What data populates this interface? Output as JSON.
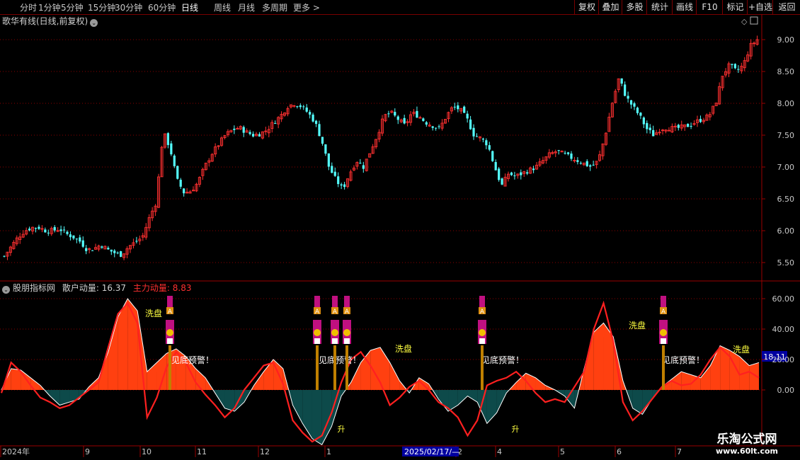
{
  "toolbar": {
    "tabs": [
      "分时",
      "1分钟",
      "5分钟",
      "15分钟",
      "30分钟",
      "60分钟",
      "日线",
      "周线",
      "月线",
      "多周期",
      "更多 >"
    ],
    "active_tab": "日线",
    "right_buttons": [
      "复权",
      "叠加",
      "多股",
      "统计",
      "画线",
      "F10",
      "标记",
      "+自选",
      "返回"
    ]
  },
  "main_panel": {
    "title": "歌华有线(日线,前复权)"
  },
  "indicator_panel": {
    "name": "股朋指标网",
    "retail_label": "散户动量: 16.37",
    "main_label": "主力动量: 8.83",
    "value_badge": "18.11"
  },
  "xaxis": {
    "labels": [
      "2024年",
      "9",
      "10",
      "11",
      "12",
      "1",
      "2",
      "4",
      "5",
      "6",
      "7"
    ],
    "cursor_date": "2025/02/17/—"
  },
  "watermark": {
    "line1": "乐淘公式网",
    "line2": "www.60lt.com"
  },
  "colors": {
    "up": "#ff3030",
    "down": "#54ffff",
    "grid": "#8b0000",
    "fill_pos": "#ff4010",
    "fill_neg": "#0d4a4a",
    "main_line": "#ff2020",
    "retail_line": "#ffffff"
  },
  "chart_data": [
    {
      "type": "candlestick",
      "title": "歌华有线(日线,前复权)",
      "ylim": [
        5.4,
        9.2
      ],
      "yticks": [
        "5.50",
        "6.00",
        "6.50",
        "7.00",
        "7.50",
        "8.00",
        "8.50",
        "9.00"
      ],
      "close_series": [
        5.6,
        5.75,
        5.9,
        6.0,
        6.05,
        6.05,
        6.0,
        6.0,
        6.03,
        5.95,
        5.9,
        5.83,
        5.7,
        5.72,
        5.78,
        5.7,
        5.65,
        5.62,
        5.75,
        5.82,
        5.9,
        6.2,
        6.45,
        7.55,
        7.3,
        6.8,
        6.6,
        6.62,
        6.75,
        7.0,
        7.2,
        7.35,
        7.5,
        7.58,
        7.62,
        7.55,
        7.5,
        7.52,
        7.58,
        7.7,
        7.8,
        7.95,
        8.0,
        7.95,
        7.85,
        7.7,
        7.4,
        7.0,
        6.8,
        6.65,
        6.9,
        7.1,
        7.0,
        7.25,
        7.5,
        7.8,
        7.85,
        7.75,
        7.65,
        7.85,
        7.8,
        7.7,
        7.65,
        7.6,
        7.8,
        7.95,
        7.9,
        7.75,
        7.5,
        7.45,
        7.35,
        7.0,
        6.7,
        6.9,
        6.85,
        6.9,
        6.95,
        7.0,
        7.1,
        7.2,
        7.25,
        7.2,
        7.15,
        7.1,
        7.05,
        7.0,
        7.1,
        7.5,
        8.0,
        8.4,
        8.1,
        7.95,
        7.8,
        7.6,
        7.5,
        7.6,
        7.62,
        7.6,
        7.62,
        7.65,
        7.7,
        7.75,
        7.8,
        8.0,
        8.45,
        8.6,
        8.5,
        8.6,
        8.9,
        9.0
      ],
      "annotations": []
    },
    {
      "type": "area",
      "title": "股朋指标网",
      "ylim": [
        -40,
        65
      ],
      "yticks": [
        "0.00",
        "20.00",
        "40.00",
        "60.00"
      ],
      "series": [
        {
          "name": "散户动量",
          "values": [
            0,
            14,
            13,
            8,
            3,
            -4,
            -10,
            -8,
            -6,
            2,
            8,
            25,
            48,
            60,
            52,
            12,
            18,
            24,
            27,
            22,
            14,
            8,
            -2,
            -12,
            -14,
            -8,
            3,
            12,
            20,
            14,
            -10,
            -22,
            -32,
            -36,
            -24,
            -4,
            5,
            18,
            26,
            28,
            18,
            6,
            -2,
            8,
            4,
            -6,
            -14,
            -10,
            -4,
            -8,
            -22,
            -15,
            -2,
            5,
            11,
            8,
            3,
            0,
            -4,
            -12,
            14,
            38,
            44,
            35,
            6,
            -12,
            -16,
            -6,
            2,
            7,
            12,
            10,
            8,
            16,
            29,
            26,
            22,
            16,
            18
          ]
        },
        {
          "name": "主力动量",
          "values": [
            -2,
            18,
            12,
            3,
            -5,
            -8,
            -12,
            -10,
            -5,
            0,
            5,
            28,
            50,
            57,
            44,
            -18,
            -5,
            15,
            25,
            18,
            5,
            -3,
            -10,
            -18,
            -12,
            0,
            8,
            16,
            18,
            4,
            -20,
            -28,
            -34,
            -30,
            -15,
            5,
            20,
            25,
            16,
            5,
            -10,
            -5,
            2,
            6,
            0,
            -8,
            -12,
            -18,
            -30,
            -20,
            3,
            6,
            8,
            12,
            6,
            -2,
            -8,
            -6,
            -8,
            2,
            12,
            40,
            57,
            32,
            -8,
            -20,
            -14,
            -6,
            2,
            6,
            3,
            4,
            10,
            20,
            28,
            22,
            10,
            12,
            8
          ]
        }
      ],
      "annotations": [
        "洗盘",
        "洗盘",
        "洗盘",
        "洗盘",
        "见底预警！",
        "见底预警！",
        "见底预警！",
        "见底预警！",
        "升",
        "升"
      ]
    }
  ]
}
